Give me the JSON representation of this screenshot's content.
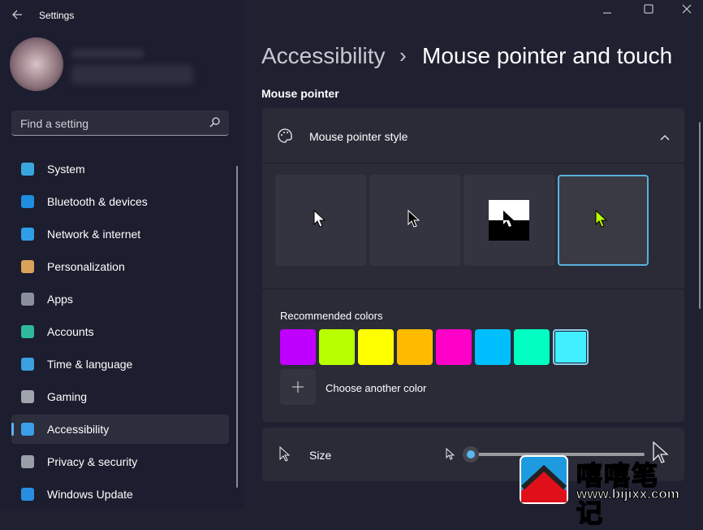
{
  "window": {
    "title": "Settings",
    "icons": [
      "back-arrow-icon",
      "minimize-icon",
      "maximize-icon",
      "close-icon"
    ]
  },
  "search": {
    "placeholder": "Find a setting"
  },
  "sidebar": {
    "items": [
      {
        "label": "System",
        "icon": "monitor-icon",
        "color": "#3aa6e0"
      },
      {
        "label": "Bluetooth & devices",
        "icon": "bluetooth-icon",
        "color": "#1f8ee0"
      },
      {
        "label": "Network & internet",
        "icon": "wifi-icon",
        "color": "#2f9ee6"
      },
      {
        "label": "Personalization",
        "icon": "brush-icon",
        "color": "#d9a25a"
      },
      {
        "label": "Apps",
        "icon": "apps-icon",
        "color": "#8a8f9c"
      },
      {
        "label": "Accounts",
        "icon": "person-icon",
        "color": "#2fb89a"
      },
      {
        "label": "Time & language",
        "icon": "clock-globe-icon",
        "color": "#3aa0e0"
      },
      {
        "label": "Gaming",
        "icon": "gamepad-icon",
        "color": "#a0a4ad"
      },
      {
        "label": "Accessibility",
        "icon": "accessibility-icon",
        "color": "#3a9ee8",
        "selected": true
      },
      {
        "label": "Privacy & security",
        "icon": "shield-icon",
        "color": "#9a9ea8"
      },
      {
        "label": "Windows Update",
        "icon": "update-icon",
        "color": "#2a8ee0"
      }
    ]
  },
  "breadcrumb": {
    "parent": "Accessibility",
    "separator": "›",
    "current": "Mouse pointer and touch"
  },
  "section": {
    "title": "Mouse pointer"
  },
  "pointer_style": {
    "label": "Mouse pointer style",
    "expanded": true,
    "styles": [
      "white",
      "black",
      "inverted",
      "custom"
    ],
    "selected_style": "custom",
    "custom_color": "#b8ff00"
  },
  "colors": {
    "label": "Recommended colors",
    "swatches": [
      "#bf00ff",
      "#b8ff00",
      "#ffff00",
      "#ffbb00",
      "#ff00c8",
      "#00bfff",
      "#00ffc0",
      "#40f0ff"
    ],
    "selected": "#40f0ff",
    "choose_label": "Choose another color"
  },
  "size": {
    "label": "Size",
    "value_fraction": 0.0
  },
  "watermark": {
    "text": "嘻嘻笔记",
    "url": "www.bijixx.com"
  }
}
